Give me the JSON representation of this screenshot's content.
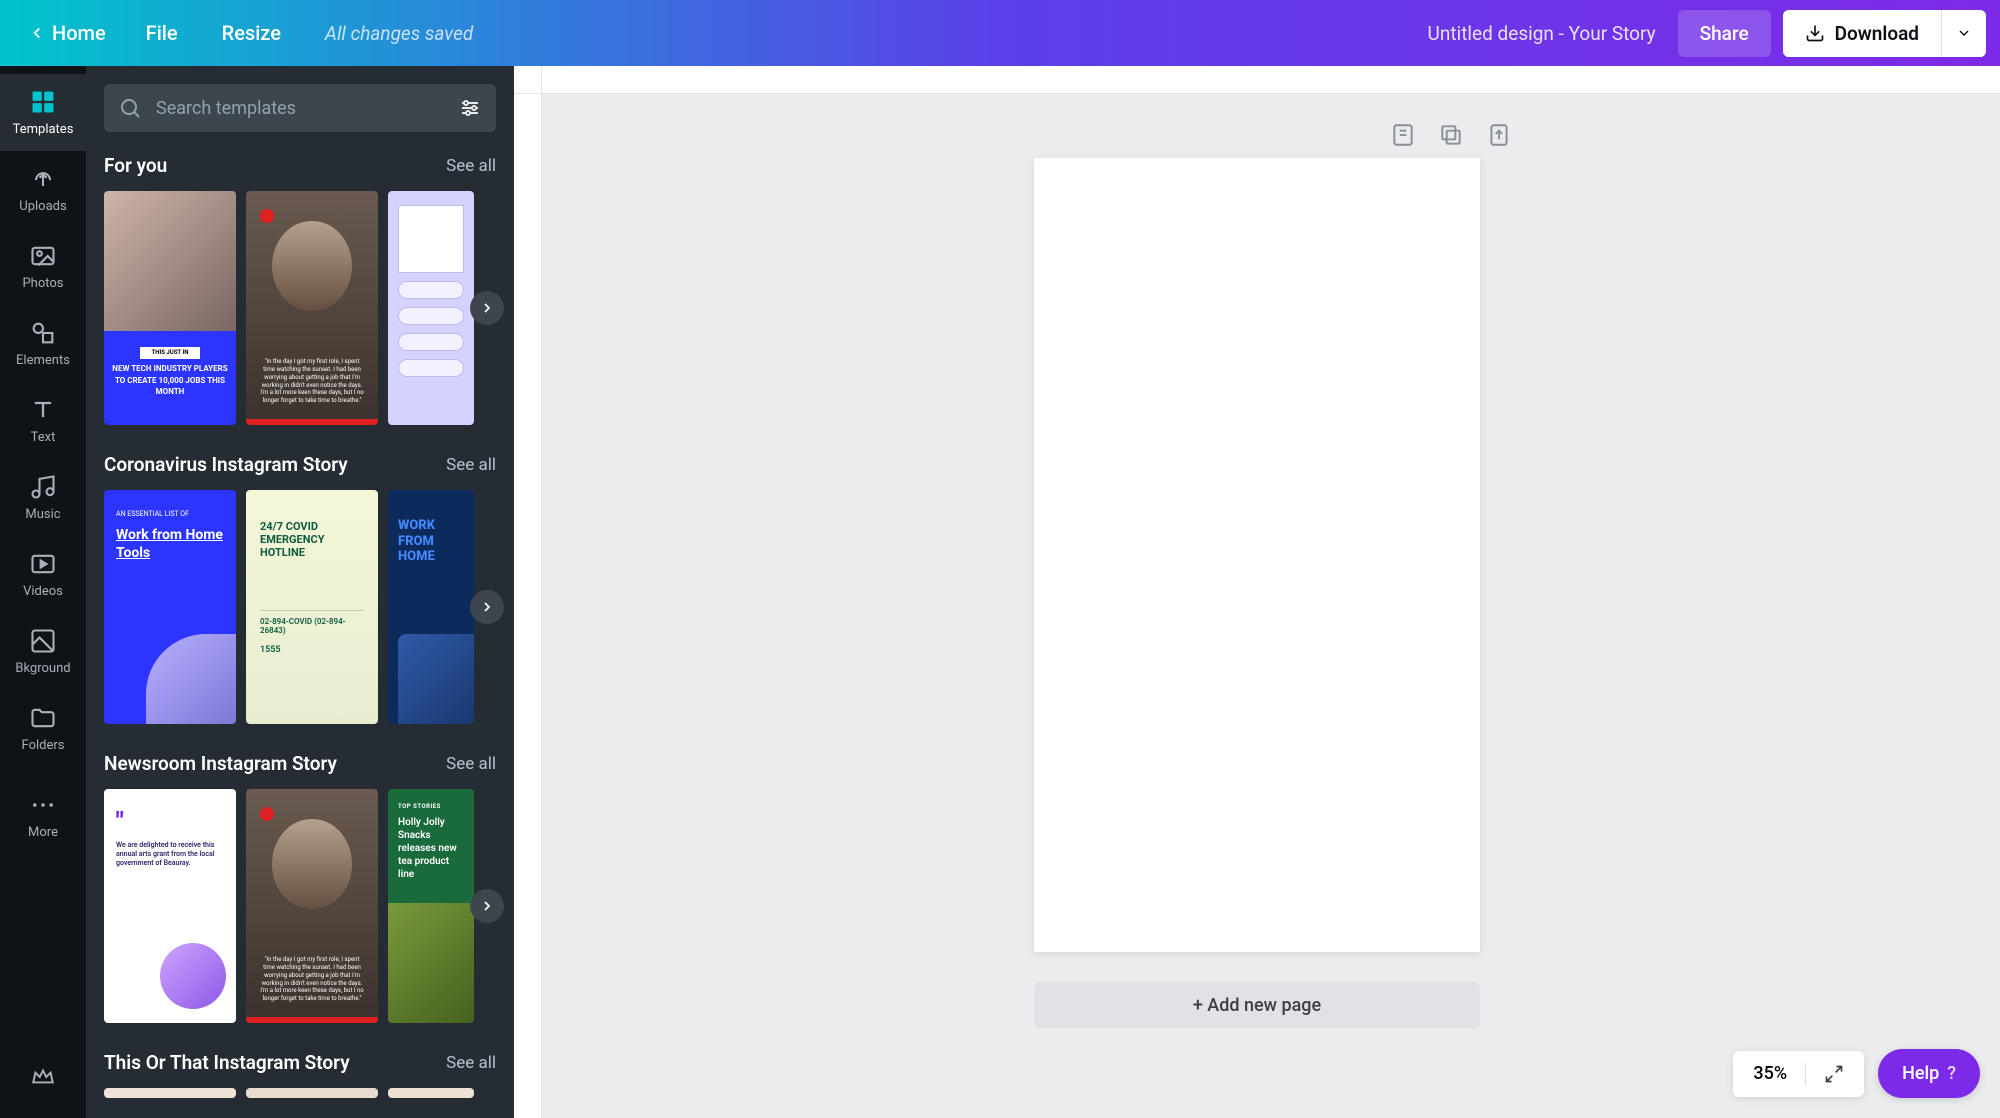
{
  "header": {
    "home": "Home",
    "file": "File",
    "resize": "Resize",
    "save_status": "All changes saved",
    "design_title": "Untitled design - Your Story",
    "share": "Share",
    "download": "Download"
  },
  "rail": {
    "templates": "Templates",
    "uploads": "Uploads",
    "photos": "Photos",
    "elements": "Elements",
    "text": "Text",
    "music": "Music",
    "videos": "Videos",
    "bkground": "Bkground",
    "folders": "Folders",
    "more": "More"
  },
  "panel": {
    "search_placeholder": "Search templates",
    "see_all": "See all",
    "sections": {
      "for_you": "For you",
      "coronavirus": "Coronavirus Instagram Story",
      "newsroom": "Newsroom Instagram Story",
      "this_or_that": "This Or That Instagram Story"
    },
    "thumbs": {
      "t1_badge": "THIS JUST IN",
      "t1_text": "NEW TECH INDUSTRY PLAYERS TO CREATE 10,000 JOBS THIS MONTH",
      "t2_quote": "\"In the day I got my first role, I spent time watching the sunset. I had been worrying about getting a job that I'm working in didn't even notice the days. I'm a lot more keen these days, but I no longer forget to take time to breathe.\"",
      "wfh_tiny": "AN ESSENTIAL LIST OF",
      "wfh_title": "Work from Home Tools",
      "green_title": "24/7 COVID EMERGENCY HOTLINE",
      "green_nums": "02-894-COVID (02-894-26843)",
      "green_1555": "1555",
      "navy_title": "WORK FROM HOME",
      "purple_text": "We are delighted to receive this annual arts grant from the local government of Beauray.",
      "greenery_top": "TOP STORIES",
      "greenery_title": "Holly Jolly Snacks releases new tea product line"
    }
  },
  "canvas": {
    "add_page": "+ Add new page"
  },
  "bottom": {
    "zoom": "35%",
    "help": "Help"
  },
  "icons": {
    "chevron_left": "chevron-left-icon",
    "chevron_right": "chevron-right-icon",
    "chevron_down": "chevron-down-icon",
    "download": "download-icon",
    "search": "search-icon",
    "filter": "filter-icon"
  }
}
